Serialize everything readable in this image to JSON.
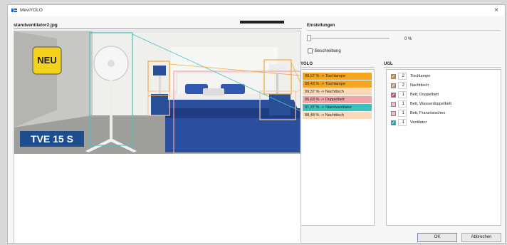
{
  "window": {
    "title": "MeviYOLO",
    "close_symbol": "×"
  },
  "image_panel": {
    "filename": "standventilator2.jpg"
  },
  "photo": {
    "badge": "NEU",
    "model": "TVE 15 S"
  },
  "settings": {
    "title": "Einstellungen",
    "slider_value": "0 %",
    "slider_level": 0,
    "description_checkbox_label": "Beschreibung",
    "description_checked": false
  },
  "yolo": {
    "title": "YOLO",
    "rows": [
      {
        "text": "99,57 % -> Tischlampe",
        "color": "#f7a51e"
      },
      {
        "text": "99,43 % -> Tischlampe",
        "color": "#f7a51e"
      },
      {
        "text": "99,37 % -> Nachttisch",
        "color": "#fbd8b8"
      },
      {
        "text": "95,63 % -> Doppelbett",
        "color": "#f2a4a9"
      },
      {
        "text": "91,37 % -> Standventilator",
        "color": "#3cc2bd"
      },
      {
        "text": "88,48 % -> Nachttisch",
        "color": "#fbd8b8"
      }
    ]
  },
  "ugl": {
    "title": "UGL",
    "rows": [
      {
        "count": "2",
        "label": "Tischlampe",
        "checked": true,
        "color": "#c98a2b"
      },
      {
        "count": "2",
        "label": "Nachttisch",
        "checked": true,
        "color": "#c7a07a"
      },
      {
        "count": "1",
        "label": "Bett, Doppelbett",
        "checked": true,
        "color": "#c05560"
      },
      {
        "count": "1",
        "label": "Bett, Wasserdoppelbett",
        "checked": false,
        "color": "#f3bcc4"
      },
      {
        "count": "1",
        "label": "Bett, Französisches",
        "checked": false,
        "color": "#f3bcc4"
      },
      {
        "count": "1",
        "label": "Ventilator",
        "checked": true,
        "color": "#2a9aa6"
      }
    ]
  },
  "buttons": {
    "ok": "OK",
    "cancel": "Abbrechen"
  },
  "colors": {
    "accent": "#1a5fb4",
    "badge_yellow": "#f2d21a",
    "model_banner": "#1d4d8c",
    "bed_blue": "#2b4f9e",
    "lamp_box": "#f0a838",
    "fan_box": "#4cc3bd",
    "nightstand_box": "#f3c9a4",
    "bed_box": "#f2a4a9"
  }
}
